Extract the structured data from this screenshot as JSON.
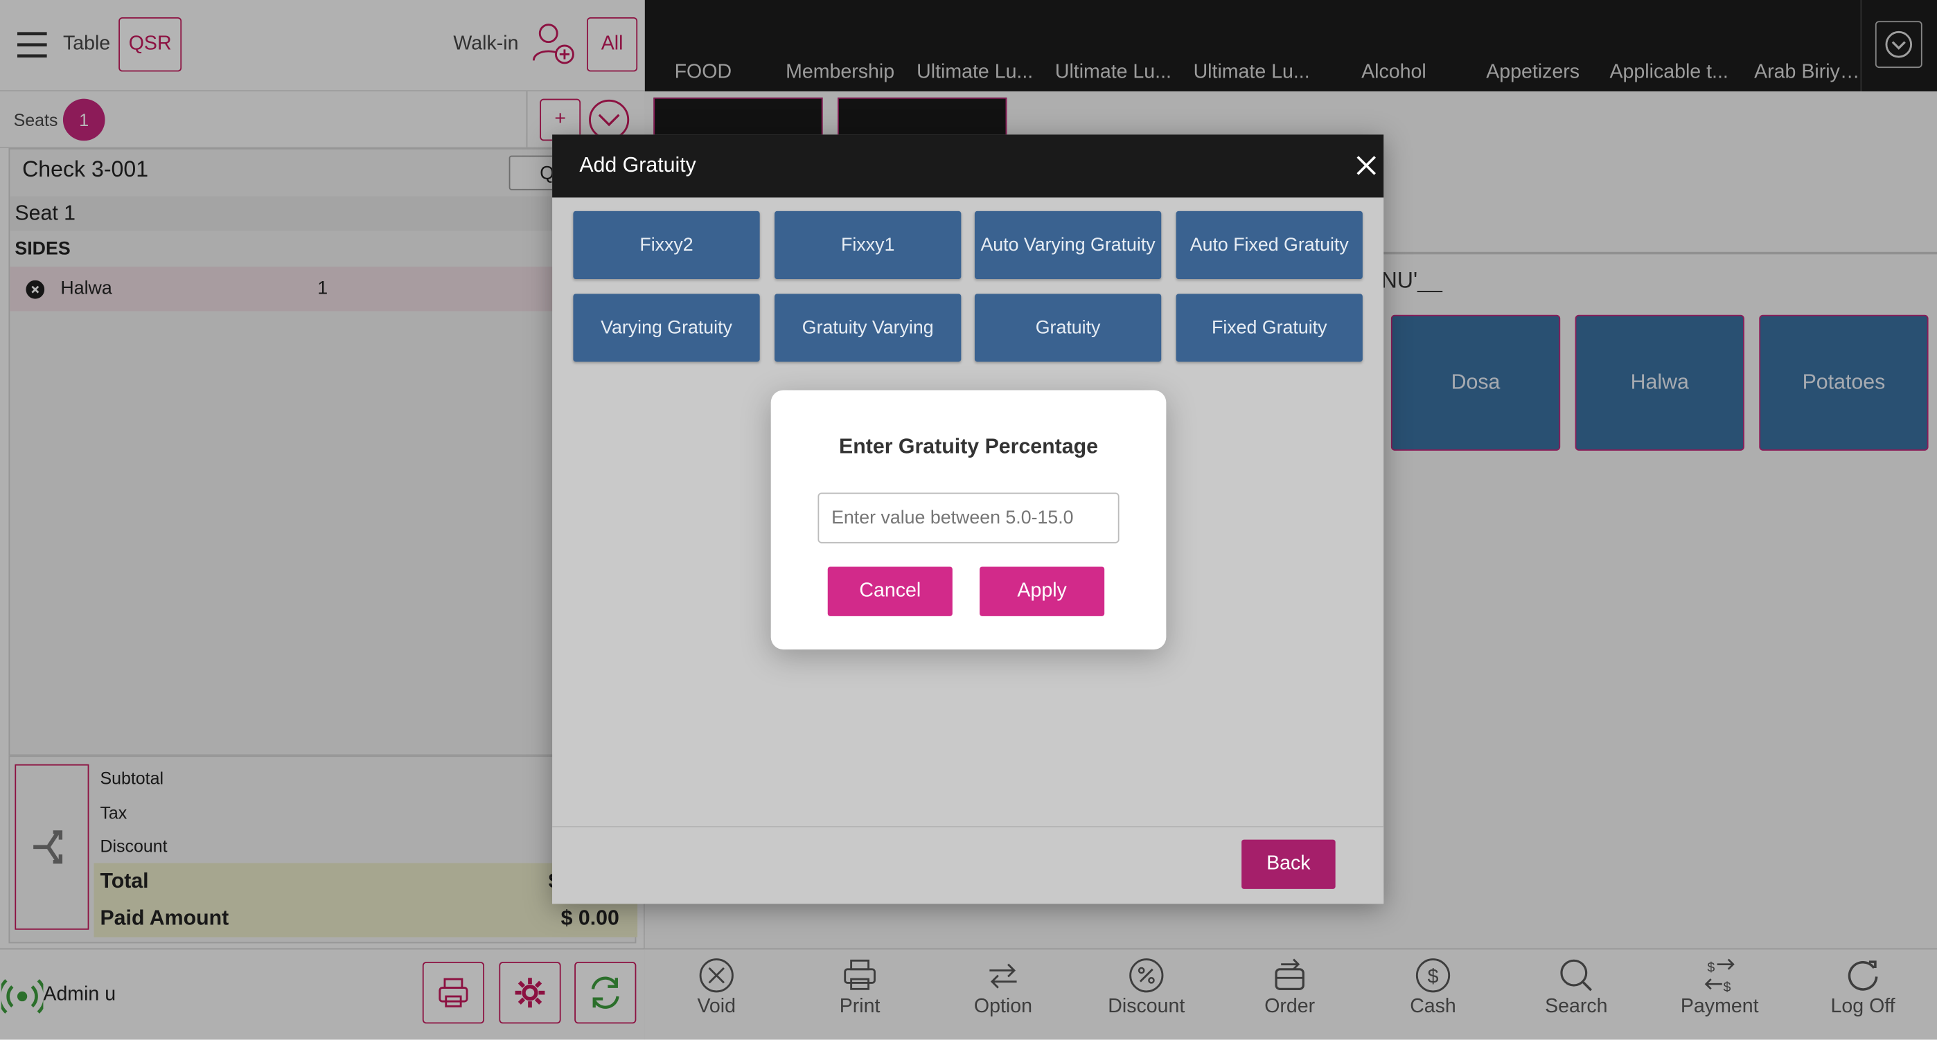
{
  "header": {
    "table_label": "Table",
    "mode_label": "QSR",
    "walkin_label": "Walk-in",
    "all_label": "All"
  },
  "seats": {
    "label": "Seats",
    "count": "1",
    "add_label": "+"
  },
  "check": {
    "title": "Check 3-001",
    "q_button": "Q",
    "seat_label": "Seat 1",
    "section": "SIDES",
    "items": [
      {
        "name": "Halwa",
        "qty": "1"
      }
    ]
  },
  "summary": {
    "subtotal_label": "Subtotal",
    "tax_label": "Tax",
    "discount_label": "Discount",
    "total_label": "Total",
    "total_value": "$",
    "paid_label": "Paid Amount",
    "paid_value": "$ 0.00"
  },
  "user": {
    "name": "Admin u"
  },
  "categories": [
    "FOOD",
    "Membership",
    "Ultimate Lu...",
    "Ultimate Lu...",
    "Ultimate Lu...",
    "Alcohol",
    "Appetizers",
    "Applicable t...",
    "Arab Biriyani"
  ],
  "menu": {
    "section_title": "NU'__",
    "items": [
      "Dosa",
      "Halwa",
      "Potatoes"
    ]
  },
  "actions": [
    "Void",
    "Print",
    "Option",
    "Discount",
    "Order",
    "Cash",
    "Search",
    "Payment",
    "Log Off"
  ],
  "dialog": {
    "title": "Add Gratuity",
    "options": [
      "Fixxy2",
      "Fixxy1",
      "Auto Varying Gratuity",
      "Auto Fixed Gratuity",
      "Varying Gratuity",
      "Gratuity Varying",
      "Gratuity",
      "Fixed Gratuity"
    ],
    "back_label": "Back"
  },
  "modal": {
    "title": "Enter Gratuity Percentage",
    "placeholder": "Enter value between 5.0-15.0",
    "cancel_label": "Cancel",
    "apply_label": "Apply"
  },
  "colors": {
    "accent": "#c2185b",
    "tile": "#3a6f9f",
    "primary_button": "#d22a8a"
  }
}
